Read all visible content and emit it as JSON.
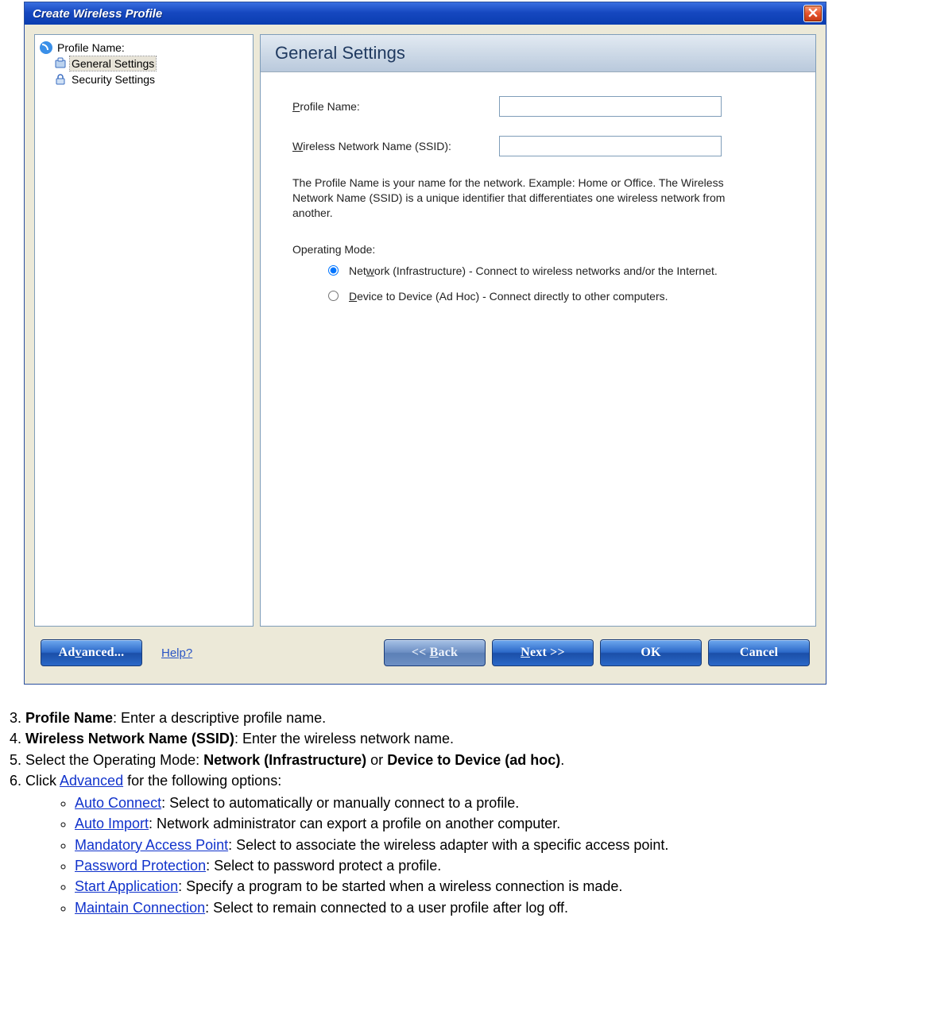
{
  "dialog": {
    "title": "Create Wireless Profile",
    "tree": {
      "root": "Profile Name:",
      "item_general": "General Settings",
      "item_security": "Security Settings"
    },
    "header": "General Settings",
    "fields": {
      "profile_name_label": "Profile Name:",
      "ssid_label": "Wireless Network Name (SSID):"
    },
    "desc": "The Profile Name is your name for the network. Example: Home or Office. The Wireless Network Name (SSID) is a unique identifier that differentiates one wireless network from another.",
    "opmode_label": "Operating Mode:",
    "radio_infra": "Network (Infrastructure) - Connect to wireless networks and/or the Internet.",
    "radio_adhoc": "Device to Device (Ad Hoc) - Connect directly to other computers.",
    "buttons": {
      "advanced": "Advanced...",
      "help": "Help?",
      "back": "<<  Back",
      "next": "Next  >>",
      "ok": "OK",
      "cancel": "Cancel"
    }
  },
  "instructions": {
    "start": 3,
    "item3_bold": "Profile Name",
    "item3_rest": ": Enter a descriptive profile name.",
    "item4_bold": "Wireless Network Name (SSID)",
    "item4_rest": ": Enter the wireless network name.",
    "item5_pre": "Select the Operating Mode: ",
    "item5_b1": "Network (Infrastructure)",
    "item5_mid": " or ",
    "item5_b2": "Device to Device (ad hoc)",
    "item5_end": ".",
    "item6_pre": "Click ",
    "item6_link": "Advanced",
    "item6_rest": " for the following options:",
    "bullets": [
      {
        "link": "Auto Connect",
        "rest": ": Select to automatically or manually connect to a profile."
      },
      {
        "link": "Auto Import",
        "rest": ": Network administrator can export a profile on another computer."
      },
      {
        "link": "Mandatory Access Point",
        "rest": ": Select to associate the wireless adapter with a specific access point."
      },
      {
        "link": "Password Protection",
        "rest": ": Select to password protect a profile."
      },
      {
        "link": "Start Application",
        "rest": ": Specify a program to be started when a wireless connection is made."
      },
      {
        "link": "Maintain Connection",
        "rest": ": Select to remain connected to a user profile after log off."
      }
    ]
  }
}
